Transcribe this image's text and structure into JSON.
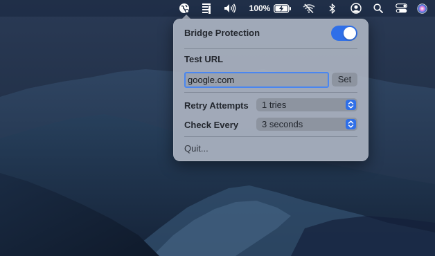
{
  "menubar": {
    "battery_percent": "100%",
    "colors": {
      "background": "#18263e"
    },
    "icons": [
      "vpn-globe-icon",
      "bridge-status-icon",
      "volume-icon",
      "battery-charging-icon",
      "wifi-off-icon",
      "bluetooth-icon",
      "user-icon",
      "spotlight-search-icon",
      "control-center-icon",
      "siri-icon"
    ]
  },
  "panel": {
    "bridge_protection_label": "Bridge Protection",
    "bridge_protection_enabled": true,
    "test_url_label": "Test URL",
    "test_url_value": "google.com",
    "set_button_label": "Set",
    "retry_attempts_label": "Retry Attempts",
    "retry_attempts_value": "1 tries",
    "check_every_label": "Check Every",
    "check_every_value": "3 seconds",
    "quit_label": "Quit...",
    "colors": {
      "accent": "#2f6fe8",
      "panel_background": "#aab2bf"
    }
  }
}
